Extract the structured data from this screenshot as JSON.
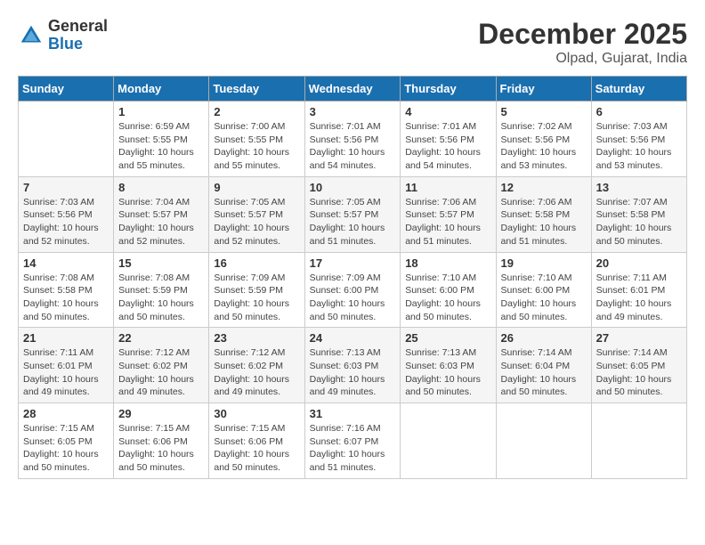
{
  "logo": {
    "general": "General",
    "blue": "Blue"
  },
  "title": "December 2025",
  "location": "Olpad, Gujarat, India",
  "header_days": [
    "Sunday",
    "Monday",
    "Tuesday",
    "Wednesday",
    "Thursday",
    "Friday",
    "Saturday"
  ],
  "weeks": [
    [
      {
        "day": "",
        "info": ""
      },
      {
        "day": "1",
        "info": "Sunrise: 6:59 AM\nSunset: 5:55 PM\nDaylight: 10 hours\nand 55 minutes."
      },
      {
        "day": "2",
        "info": "Sunrise: 7:00 AM\nSunset: 5:55 PM\nDaylight: 10 hours\nand 55 minutes."
      },
      {
        "day": "3",
        "info": "Sunrise: 7:01 AM\nSunset: 5:56 PM\nDaylight: 10 hours\nand 54 minutes."
      },
      {
        "day": "4",
        "info": "Sunrise: 7:01 AM\nSunset: 5:56 PM\nDaylight: 10 hours\nand 54 minutes."
      },
      {
        "day": "5",
        "info": "Sunrise: 7:02 AM\nSunset: 5:56 PM\nDaylight: 10 hours\nand 53 minutes."
      },
      {
        "day": "6",
        "info": "Sunrise: 7:03 AM\nSunset: 5:56 PM\nDaylight: 10 hours\nand 53 minutes."
      }
    ],
    [
      {
        "day": "7",
        "info": "Sunrise: 7:03 AM\nSunset: 5:56 PM\nDaylight: 10 hours\nand 52 minutes."
      },
      {
        "day": "8",
        "info": "Sunrise: 7:04 AM\nSunset: 5:57 PM\nDaylight: 10 hours\nand 52 minutes."
      },
      {
        "day": "9",
        "info": "Sunrise: 7:05 AM\nSunset: 5:57 PM\nDaylight: 10 hours\nand 52 minutes."
      },
      {
        "day": "10",
        "info": "Sunrise: 7:05 AM\nSunset: 5:57 PM\nDaylight: 10 hours\nand 51 minutes."
      },
      {
        "day": "11",
        "info": "Sunrise: 7:06 AM\nSunset: 5:57 PM\nDaylight: 10 hours\nand 51 minutes."
      },
      {
        "day": "12",
        "info": "Sunrise: 7:06 AM\nSunset: 5:58 PM\nDaylight: 10 hours\nand 51 minutes."
      },
      {
        "day": "13",
        "info": "Sunrise: 7:07 AM\nSunset: 5:58 PM\nDaylight: 10 hours\nand 50 minutes."
      }
    ],
    [
      {
        "day": "14",
        "info": "Sunrise: 7:08 AM\nSunset: 5:58 PM\nDaylight: 10 hours\nand 50 minutes."
      },
      {
        "day": "15",
        "info": "Sunrise: 7:08 AM\nSunset: 5:59 PM\nDaylight: 10 hours\nand 50 minutes."
      },
      {
        "day": "16",
        "info": "Sunrise: 7:09 AM\nSunset: 5:59 PM\nDaylight: 10 hours\nand 50 minutes."
      },
      {
        "day": "17",
        "info": "Sunrise: 7:09 AM\nSunset: 6:00 PM\nDaylight: 10 hours\nand 50 minutes."
      },
      {
        "day": "18",
        "info": "Sunrise: 7:10 AM\nSunset: 6:00 PM\nDaylight: 10 hours\nand 50 minutes."
      },
      {
        "day": "19",
        "info": "Sunrise: 7:10 AM\nSunset: 6:00 PM\nDaylight: 10 hours\nand 50 minutes."
      },
      {
        "day": "20",
        "info": "Sunrise: 7:11 AM\nSunset: 6:01 PM\nDaylight: 10 hours\nand 49 minutes."
      }
    ],
    [
      {
        "day": "21",
        "info": "Sunrise: 7:11 AM\nSunset: 6:01 PM\nDaylight: 10 hours\nand 49 minutes."
      },
      {
        "day": "22",
        "info": "Sunrise: 7:12 AM\nSunset: 6:02 PM\nDaylight: 10 hours\nand 49 minutes."
      },
      {
        "day": "23",
        "info": "Sunrise: 7:12 AM\nSunset: 6:02 PM\nDaylight: 10 hours\nand 49 minutes."
      },
      {
        "day": "24",
        "info": "Sunrise: 7:13 AM\nSunset: 6:03 PM\nDaylight: 10 hours\nand 49 minutes."
      },
      {
        "day": "25",
        "info": "Sunrise: 7:13 AM\nSunset: 6:03 PM\nDaylight: 10 hours\nand 50 minutes."
      },
      {
        "day": "26",
        "info": "Sunrise: 7:14 AM\nSunset: 6:04 PM\nDaylight: 10 hours\nand 50 minutes."
      },
      {
        "day": "27",
        "info": "Sunrise: 7:14 AM\nSunset: 6:05 PM\nDaylight: 10 hours\nand 50 minutes."
      }
    ],
    [
      {
        "day": "28",
        "info": "Sunrise: 7:15 AM\nSunset: 6:05 PM\nDaylight: 10 hours\nand 50 minutes."
      },
      {
        "day": "29",
        "info": "Sunrise: 7:15 AM\nSunset: 6:06 PM\nDaylight: 10 hours\nand 50 minutes."
      },
      {
        "day": "30",
        "info": "Sunrise: 7:15 AM\nSunset: 6:06 PM\nDaylight: 10 hours\nand 50 minutes."
      },
      {
        "day": "31",
        "info": "Sunrise: 7:16 AM\nSunset: 6:07 PM\nDaylight: 10 hours\nand 51 minutes."
      },
      {
        "day": "",
        "info": ""
      },
      {
        "day": "",
        "info": ""
      },
      {
        "day": "",
        "info": ""
      }
    ]
  ]
}
